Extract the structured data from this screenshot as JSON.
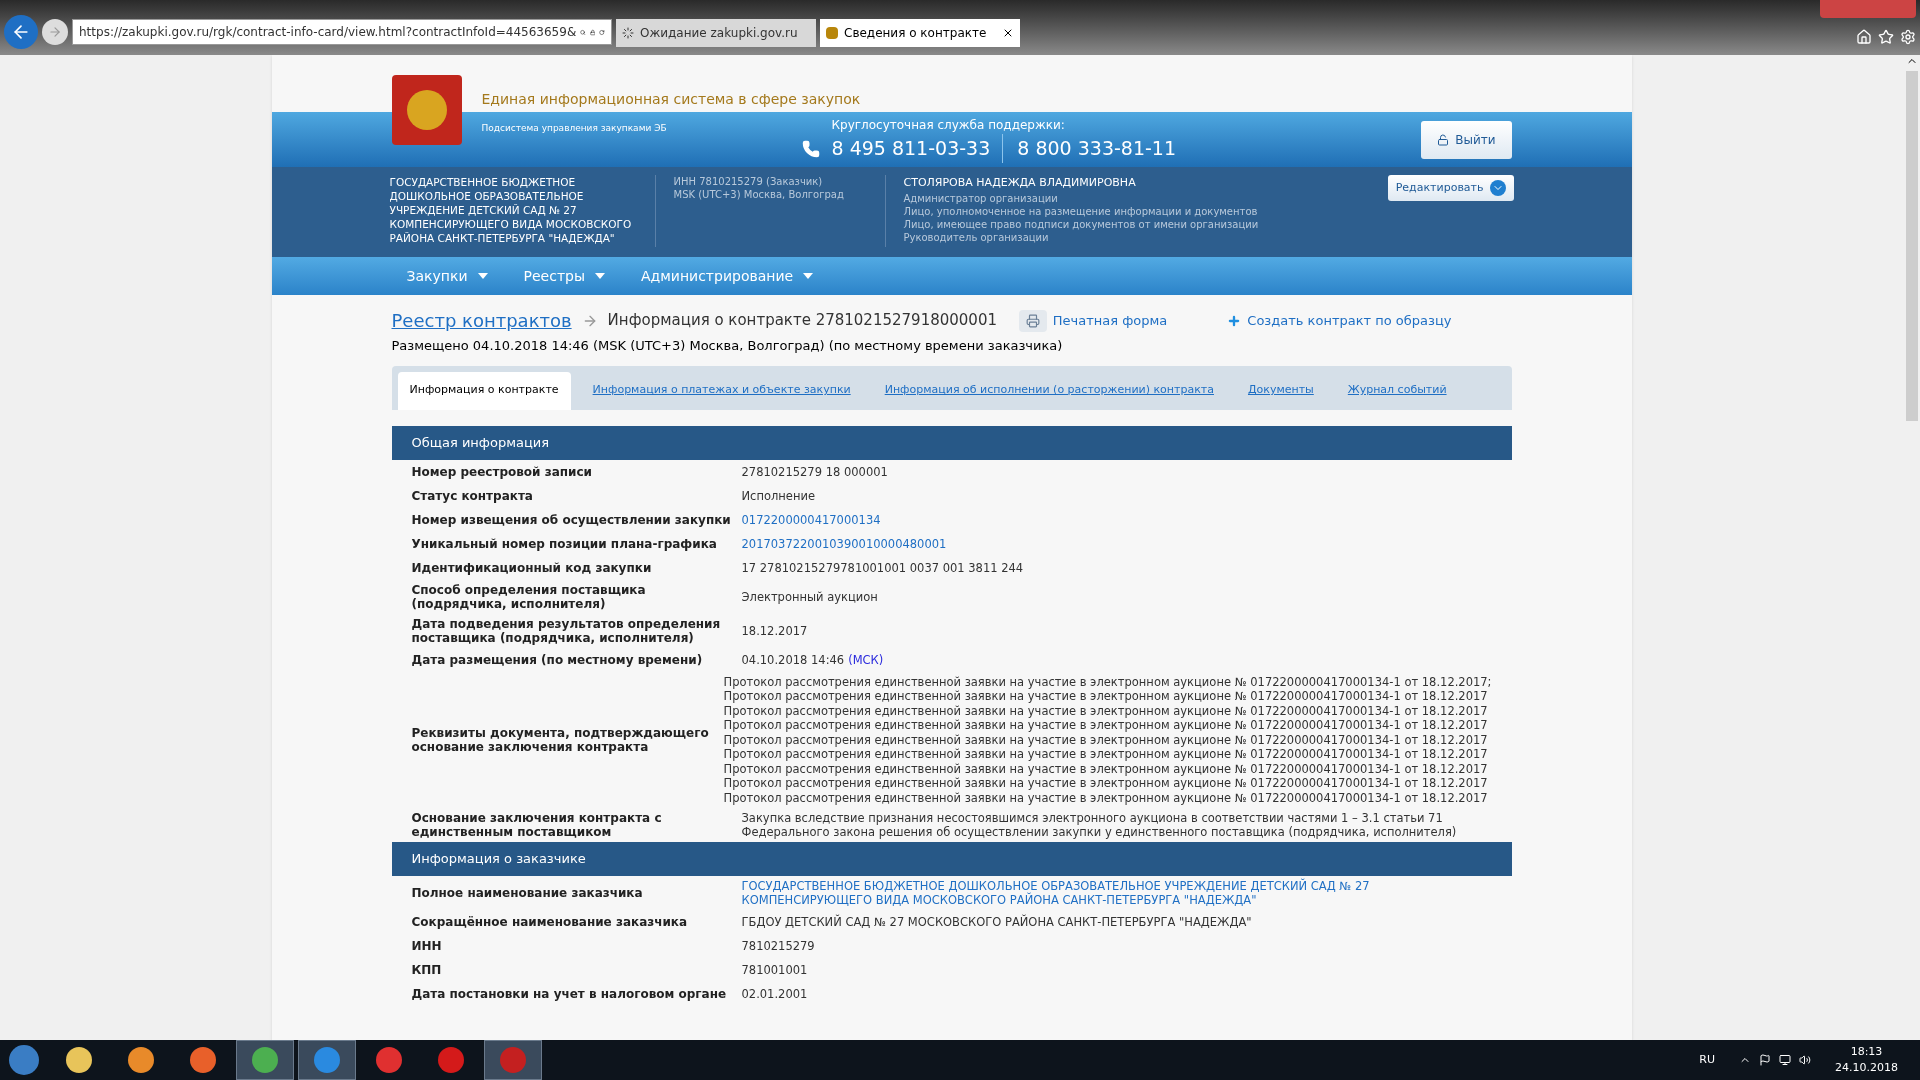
{
  "browser": {
    "url": "https://zakupki.gov.ru/rgk/contract-info-card/view.html?contractInfoId=44563659&",
    "tabs": [
      {
        "title": "Ожидание zakupki.gov.ru",
        "selected": false,
        "kind": "loading"
      },
      {
        "title": "Сведения о контракте",
        "selected": true,
        "kind": "site"
      }
    ]
  },
  "header": {
    "site_title": "Единая информационная система в сфере закупок",
    "subsystem": "Подсистема управления закупками ЭБ",
    "support_label": "Круглосуточная служба поддержки:",
    "phones": [
      "8 495 811-03-33",
      "8 800 333-81-11"
    ],
    "logout": "Выйти"
  },
  "org": {
    "name": "ГОСУДАРСТВЕННОЕ БЮДЖЕТНОЕ ДОШКОЛЬНОЕ ОБРАЗОВАТЕЛЬНОЕ УЧРЕЖДЕНИЕ ДЕТСКИЙ САД № 27 КОМПЕНСИРУЮЩЕГО ВИДА МОСКОВСКОГО РАЙОНА САНКТ-ПЕТЕРБУРГА \"НАДЕЖДА\"",
    "details": [
      "ИНН 7810215279 (Заказчик)",
      "MSK (UTC+3) Москва, Волгоград"
    ],
    "user": "СТОЛЯРОВА НАДЕЖДА ВЛАДИМИРОВНА",
    "roles": [
      "Администратор организации",
      "Лицо, уполномоченное на размещение информации и документов",
      "Лицо, имеющее право подписи документов от имени организации",
      "Руководитель организации"
    ],
    "edit": "Редактировать"
  },
  "nav": [
    "Закупки",
    "Реестры",
    "Администрирование"
  ],
  "breadcrumb": {
    "link": "Реестр контрактов",
    "current": "Информация о контракте 2781021527918000001"
  },
  "actions": [
    "Печатная форма",
    "Создать контракт по образцу"
  ],
  "posted": "Размещено 04.10.2018 14:46 (MSK (UTC+3) Москва, Волгоград) (по местному времени заказчика)",
  "content_tabs": [
    {
      "label": "Информация о контракте",
      "selected": true
    },
    {
      "label": "Информация о платежах и объекте закупки",
      "selected": false
    },
    {
      "label": "Информация об исполнении (о расторжении) контракта",
      "selected": false
    },
    {
      "label": "Документы",
      "selected": false
    },
    {
      "label": "Журнал событий",
      "selected": false
    }
  ],
  "sections": [
    {
      "title": "Общая информация",
      "rows": [
        {
          "label": "Номер реестровой записи",
          "values": [
            "27810215279 18 000001"
          ],
          "kind": "text"
        },
        {
          "label": "Статус контракта",
          "values": [
            "Исполнение"
          ],
          "kind": "text"
        },
        {
          "label": "Номер извещения об осуществлении закупки",
          "values": [
            "0172200000417000134"
          ],
          "kind": "link"
        },
        {
          "label": "Уникальный номер позиции плана-графика",
          "values": [
            "2017037220010390010000480001"
          ],
          "kind": "link"
        },
        {
          "label": "Идентификационный код закупки",
          "values": [
            "17 27810215279781001001 0037 001 3811 244"
          ],
          "kind": "text"
        },
        {
          "label": "Способ определения поставщика (подрядчика, исполнителя)",
          "values": [
            "Электронный аукцион"
          ],
          "kind": "text"
        },
        {
          "label": "Дата подведения результатов определения поставщика (подрядчика, исполнителя)",
          "values": [
            "18.12.2017"
          ],
          "kind": "text"
        },
        {
          "label": "Дата размещения (по местному времени)",
          "values": [
            "04.10.2018 14:46"
          ],
          "suffix": "(МСК)",
          "kind": "text"
        },
        {
          "label": "Реквизиты документа, подтверждающего основание заключения контракта",
          "kind": "lines",
          "values": [
            "Протокол рассмотрения единственной заявки на участие в электронном аукционе № 0172200000417000134-1 от 18.12.2017;",
            "Протокол рассмотрения единственной заявки на участие в электронном аукционе № 0172200000417000134-1 от 18.12.2017",
            "Протокол рассмотрения единственной заявки на участие в электронном аукционе № 0172200000417000134-1 от 18.12.2017",
            "Протокол рассмотрения единственной заявки на участие в электронном аукционе № 0172200000417000134-1 от 18.12.2017",
            "Протокол рассмотрения единственной заявки на участие в электронном аукционе № 0172200000417000134-1 от 18.12.2017",
            "Протокол рассмотрения единственной заявки на участие в электронном аукционе № 0172200000417000134-1 от 18.12.2017",
            "Протокол рассмотрения единственной заявки на участие в электронном аукционе № 0172200000417000134-1 от 18.12.2017",
            "Протокол рассмотрения единственной заявки на участие в электронном аукционе № 0172200000417000134-1 от 18.12.2017",
            "Протокол рассмотрения единственной заявки на участие в электронном аукционе № 0172200000417000134-1 от 18.12.2017"
          ]
        },
        {
          "label": "Основание заключения контракта с единственным поставщиком",
          "values": [
            "Закупка вследствие признания несостоявшимся электронного аукциона в соответствии частями 1 – 3.1 статьи 71 Федерального закона решения об осуществлении закупки у единственного поставщика (подрядчика, исполнителя)"
          ],
          "kind": "text"
        }
      ]
    },
    {
      "title": "Информация о заказчике",
      "rows": [
        {
          "label": "Полное наименование заказчика",
          "values": [
            "ГОСУДАРСТВЕННОЕ БЮДЖЕТНОЕ ДОШКОЛЬНОЕ ОБРАЗОВАТЕЛЬНОЕ УЧРЕЖДЕНИЕ ДЕТСКИЙ САД № 27 КОМПЕНСИРУЮЩЕГО ВИДА МОСКОВСКОГО РАЙОНА САНКТ-ПЕТЕРБУРГА \"НАДЕЖДА\""
          ],
          "kind": "link"
        },
        {
          "label": "Сокращённое наименование заказчика",
          "values": [
            "ГБДОУ ДЕТСКИЙ САД № 27 МОСКОВСКОГО РАЙОНА САНКТ-ПЕТЕРБУРГА \"НАДЕЖДА\""
          ],
          "kind": "text"
        },
        {
          "label": "ИНН",
          "values": [
            "7810215279"
          ],
          "kind": "text"
        },
        {
          "label": "КПП",
          "values": [
            "781001001"
          ],
          "kind": "text"
        },
        {
          "label": "Дата постановки на учет в налоговом органе",
          "values": [
            "02.01.2001"
          ],
          "kind": "text"
        }
      ]
    }
  ],
  "taskbar": {
    "language": "RU",
    "time": "18:13",
    "date": "24.10.2018"
  }
}
